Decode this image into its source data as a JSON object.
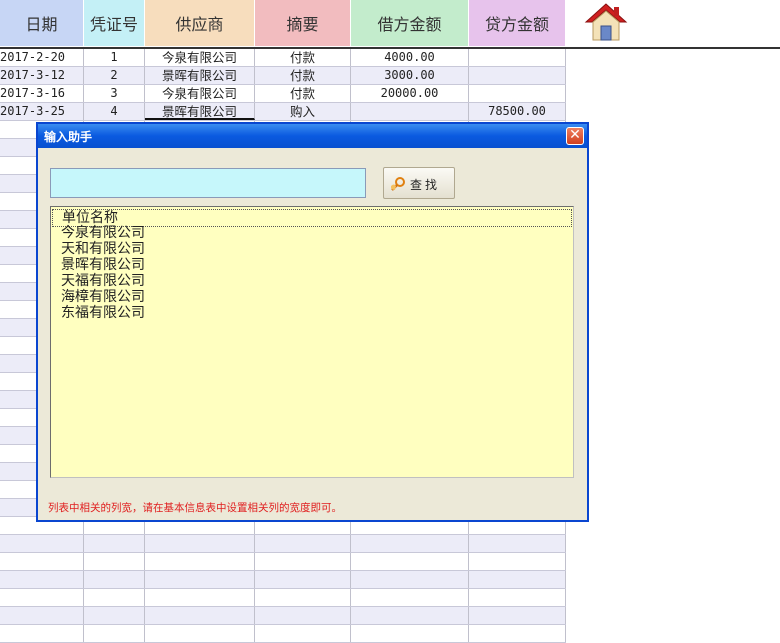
{
  "table": {
    "columns": [
      {
        "label": "日期",
        "color": "#c7d6f5"
      },
      {
        "label": "凭证号",
        "color": "#c4f0f6"
      },
      {
        "label": "供应商",
        "color": "#f7ddbd"
      },
      {
        "label": "摘要",
        "color": "#f2bcbf"
      },
      {
        "label": "借方金额",
        "color": "#c3eccc"
      },
      {
        "label": "贷方金额",
        "color": "#e7c3ec"
      }
    ],
    "rows": [
      [
        "2017-2-20",
        "1",
        "今泉有限公司",
        "付款",
        "4000.00",
        ""
      ],
      [
        "2017-3-12",
        "2",
        "景晖有限公司",
        "付款",
        "3000.00",
        ""
      ],
      [
        "2017-3-16",
        "3",
        "今泉有限公司",
        "付款",
        "20000.00",
        ""
      ],
      [
        "2017-3-25",
        "4",
        "景晖有限公司",
        "购入",
        "",
        "78500.00"
      ]
    ]
  },
  "home_icon": "home-icon",
  "dialog": {
    "title": "输入助手",
    "close_glyph": "✕",
    "search": {
      "value": "",
      "placeholder": ""
    },
    "find_label": "查找",
    "find_icon": "magnifier-hand-icon",
    "list_header": "单位名称",
    "list_items": [
      "今泉有限公司",
      "天和有限公司",
      "景晖有限公司",
      "天福有限公司",
      "海樟有限公司",
      "东福有限公司"
    ],
    "note": "列表中相关的列宽，请在基本信息表中设置相关列的宽度即可。"
  }
}
